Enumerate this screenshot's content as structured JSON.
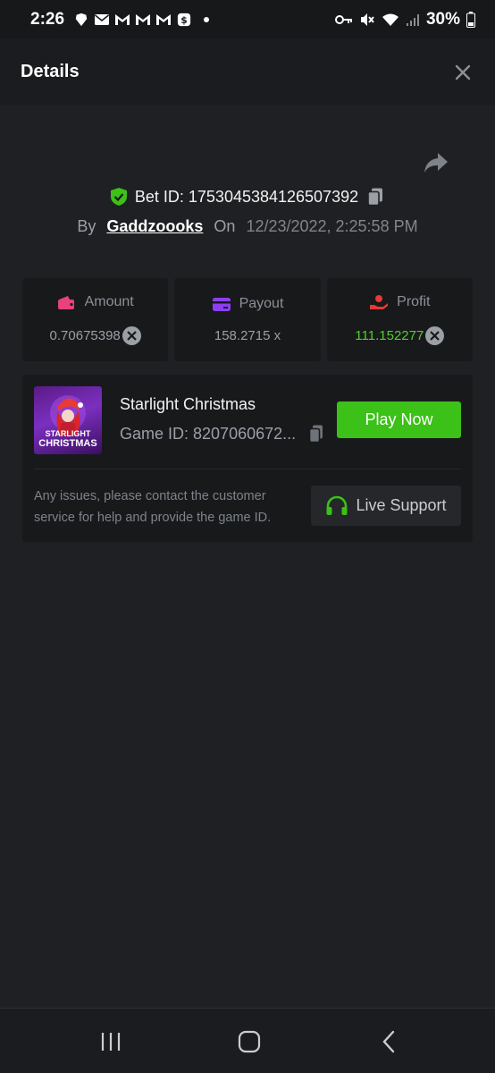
{
  "status_bar": {
    "time": "2:26",
    "battery": "30%",
    "left_icons": [
      "brave-icon",
      "mail-icon",
      "gmail-icon",
      "gmail-icon",
      "gmail-icon",
      "cash-app-icon"
    ],
    "right_icons": [
      "key-icon",
      "mute-icon",
      "wifi-icon",
      "signal-icon",
      "battery-icon"
    ]
  },
  "header": {
    "title": "Details",
    "close_icon": "close-icon"
  },
  "bet": {
    "label": "Bet ID: 1753045384126507392",
    "by_label": "By",
    "username": "Gaddzoooks",
    "on_label": "On",
    "date": "12/23/2022, 2:25:58 PM"
  },
  "stats": {
    "amount": {
      "label": "Amount",
      "value": "0.70675398"
    },
    "payout": {
      "label": "Payout",
      "value": "158.2715 x"
    },
    "profit": {
      "label": "Profit",
      "value": "111.152277"
    }
  },
  "game": {
    "title": "Starlight Christmas",
    "game_id": "Game ID: 8207060672...",
    "thumb_line1": "STARLIGHT",
    "thumb_line2": "CHRISTMAS",
    "play_label": "Play Now",
    "help_text": "Any issues, please contact the customer service for help and provide the game ID.",
    "support_label": "Live Support"
  },
  "colors": {
    "accent_green": "#3bc117",
    "profit_green": "#4fd12b",
    "amount_pink": "#e8427a",
    "payout_purple": "#8b3ff0",
    "profit_red": "#e53935"
  }
}
